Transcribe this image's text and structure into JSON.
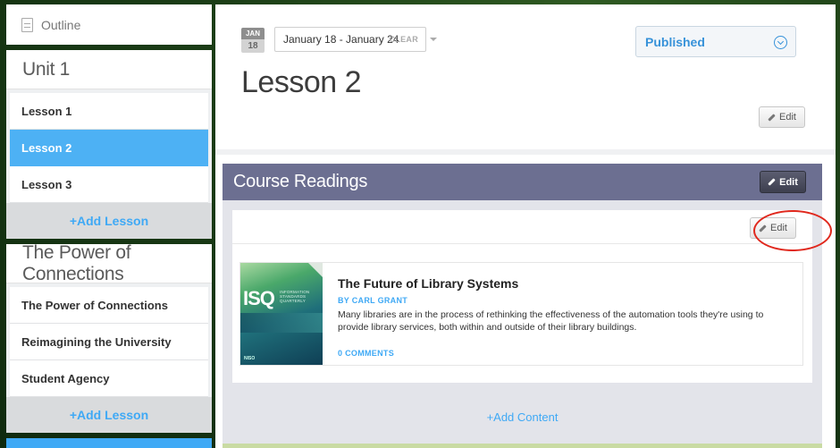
{
  "sidebar": {
    "outline_label": "Outline",
    "units": [
      {
        "title": "Unit 1",
        "lessons": [
          "Lesson 1",
          "Lesson 2",
          "Lesson 3"
        ],
        "active_lesson": "Lesson 2",
        "add_label": "+Add Lesson"
      },
      {
        "title": "The Power of Connections",
        "lessons": [
          "The Power of Connections",
          "Reimagining the University",
          "Student Agency"
        ],
        "add_label": "+Add Lesson"
      }
    ]
  },
  "header": {
    "date_badge": {
      "month": "JAN",
      "day": "18"
    },
    "date_range": "January 18 - January 24",
    "clear_label": "CLEAR",
    "status": "Published",
    "title": "Lesson 2",
    "edit_label": "Edit"
  },
  "readings": {
    "title": "Course Readings",
    "header_edit_label": "Edit",
    "card_edit_label": "Edit",
    "item": {
      "cover_text": "ISQ",
      "cover_subtitle": "INFORMATION STANDARDS QUARTERLY",
      "title": "The Future of Library Systems",
      "author": "BY CARL GRANT",
      "description": "Many libraries are in the process of rethinking the effectiveness of the automation tools they're using to provide library services, both within and outside of their library buildings.",
      "comments": "0 COMMENTS"
    },
    "add_content_label": "+Add Content"
  },
  "colors": {
    "accent_blue": "#3fa9f5",
    "active_item": "#4db1f4",
    "readings_header": "#6c6f91",
    "highlight_ring": "#e0281d"
  }
}
